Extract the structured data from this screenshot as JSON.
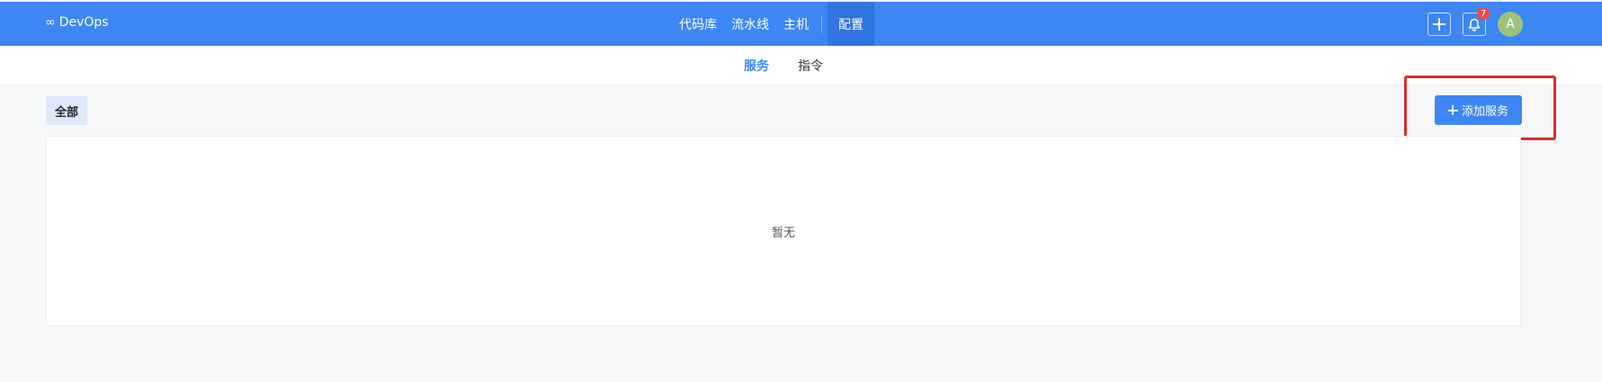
{
  "app": {
    "name": "DevOps",
    "logo_glyph": "∞"
  },
  "topnav": {
    "items": [
      {
        "label": "代码库"
      },
      {
        "label": "流水线"
      },
      {
        "label": "主机"
      },
      {
        "label": "配置",
        "active": true
      }
    ],
    "notifications_count": "7",
    "avatar_initial": "A"
  },
  "subnav": {
    "tabs": [
      {
        "label": "服务",
        "active": true
      },
      {
        "label": "指令"
      }
    ]
  },
  "filter": {
    "label": "全部"
  },
  "actions": {
    "add_service_label": "添加服务"
  },
  "content": {
    "empty_text": "暂无"
  },
  "colors": {
    "primary": "#3d86f6",
    "highlight": "#e02a2a",
    "badge": "#f04a4a"
  }
}
